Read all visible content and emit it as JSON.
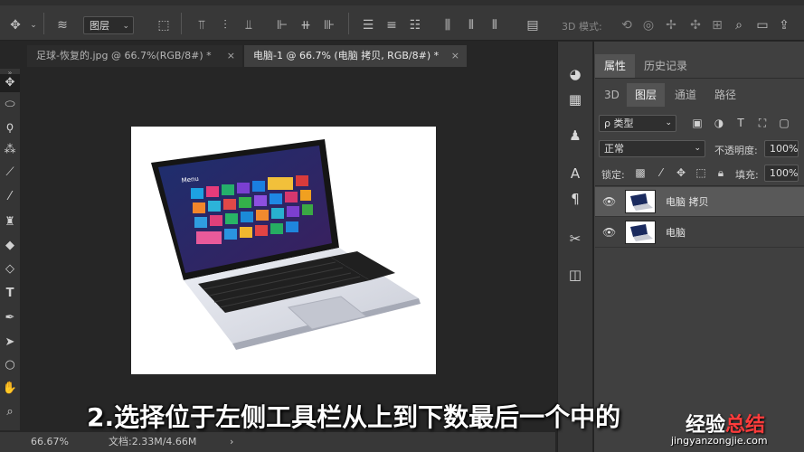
{
  "options_bar": {
    "layer_select": "图层",
    "mode_3d": "3D 模式:"
  },
  "tabs": [
    {
      "label": "足球-恢复的.jpg @ 66.7%(RGB/8#) *",
      "close": "×"
    },
    {
      "label": "电脑-1 @ 66.7% (电脑 拷贝, RGB/8#) *",
      "close": "×"
    }
  ],
  "status": {
    "zoom": "66.67%",
    "doc": "文档:2.33M/4.66M",
    "arrow": "›"
  },
  "panel": {
    "tabs": [
      "属性",
      "历史记录"
    ],
    "subtabs": [
      "3D",
      "图层",
      "通道",
      "路径"
    ],
    "filter": "ρ 类型",
    "blend_mode": "正常",
    "opacity_label": "不透明度:",
    "opacity_value": "100%",
    "lock_label": "锁定:",
    "fill_label": "填充:",
    "fill_value": "100%",
    "layers": [
      {
        "name": "电脑 拷贝",
        "selected": true
      },
      {
        "name": "电脑",
        "selected": false
      }
    ]
  },
  "caption": "2.选择位于左侧工具栏从上到下数最后一个中的",
  "watermark": {
    "cn_a": "经验",
    "cn_b": "总结",
    "en": "jingyanzongjie.com"
  },
  "laptop": {
    "screen_title": "Menu"
  }
}
